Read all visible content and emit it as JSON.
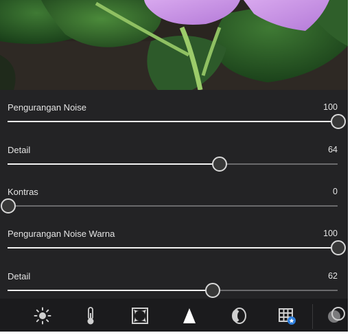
{
  "photo": {
    "description_icon": "flower-photo"
  },
  "sliders": [
    {
      "label": "Pengurangan Noise",
      "value": "100",
      "level": 100
    },
    {
      "label": "Detail",
      "value": "64",
      "level": 64
    },
    {
      "label": "Kontras",
      "value": "0",
      "level": 0
    },
    {
      "label": "Pengurangan Noise Warna",
      "value": "100",
      "level": 100
    },
    {
      "label": "Detail",
      "value": "62",
      "level": 62
    }
  ],
  "toolbar": {
    "tools": [
      "light-icon",
      "color-icon",
      "effects-icon",
      "detail-icon",
      "optics-icon",
      "geometry-icon",
      "presets-icon"
    ],
    "active": "detail-icon",
    "accent": "#2f7fdc"
  }
}
